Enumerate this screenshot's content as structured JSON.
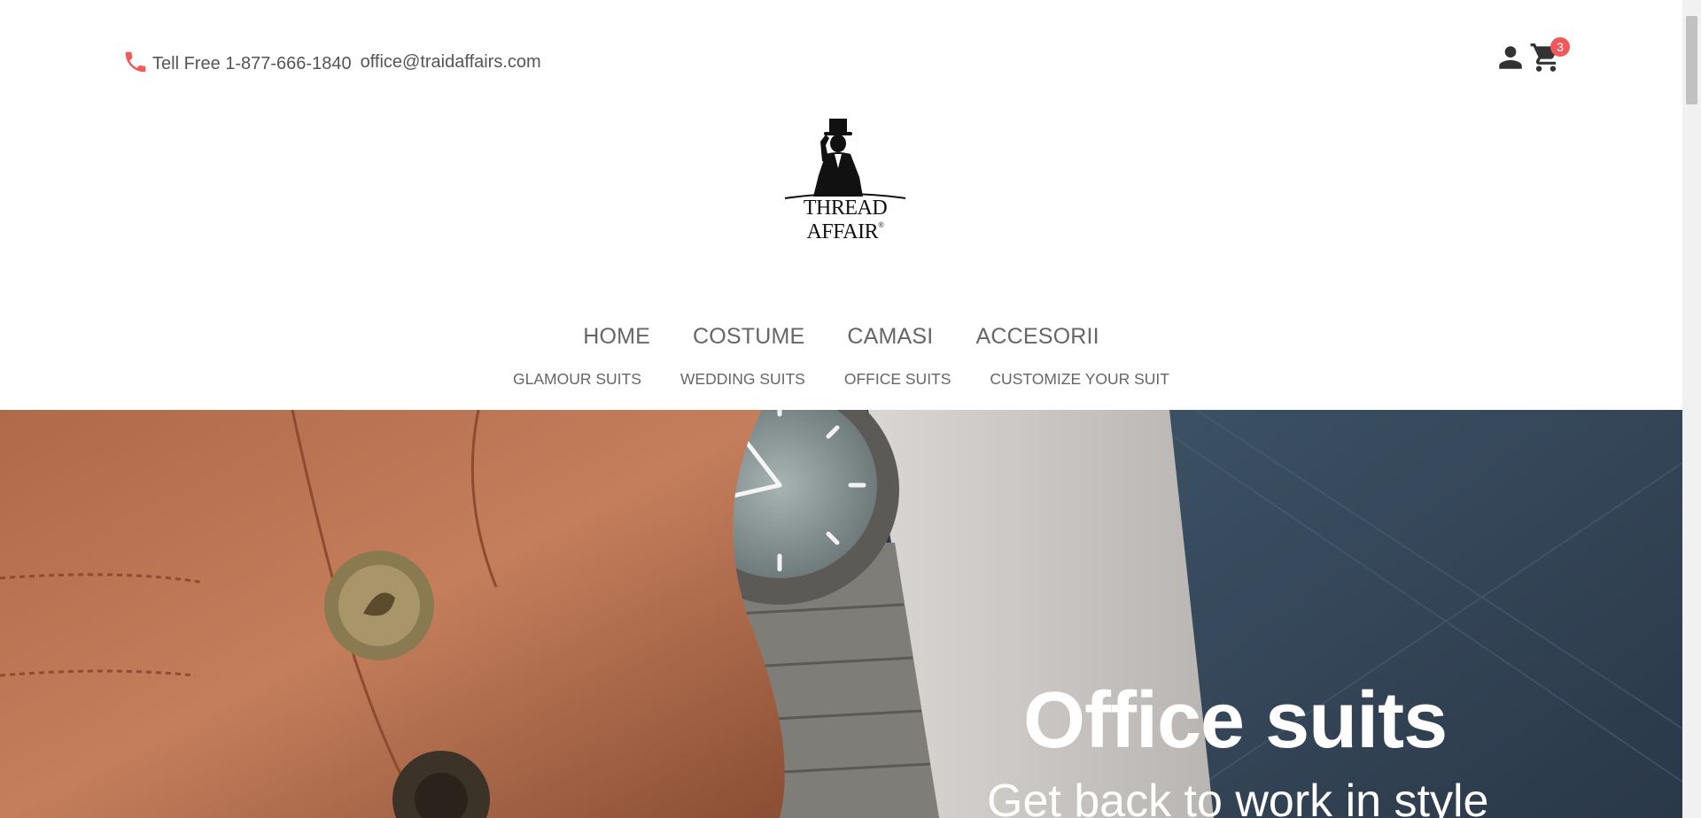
{
  "header": {
    "phone": "Tell Free 1-877-666-1840",
    "email": "office@traidaffairs.com",
    "cart_count": "3",
    "accent_color": "#f05a5a"
  },
  "logo": {
    "text": "THREAD AFFAIR",
    "reg_mark": "®"
  },
  "nav": {
    "main": [
      "HOME",
      "COSTUME",
      "CAMASI",
      "ACCESORII"
    ],
    "sub": [
      "GLAMOUR SUITS",
      "WEDDING SUITS",
      "OFFICE SUITS",
      "CUSTOMIZE YOUR SUIT"
    ]
  },
  "hero": {
    "title": "Office suits",
    "subtitle": "Get back to work in style"
  },
  "icons": [
    "phone-icon",
    "user-icon",
    "cart-icon"
  ]
}
